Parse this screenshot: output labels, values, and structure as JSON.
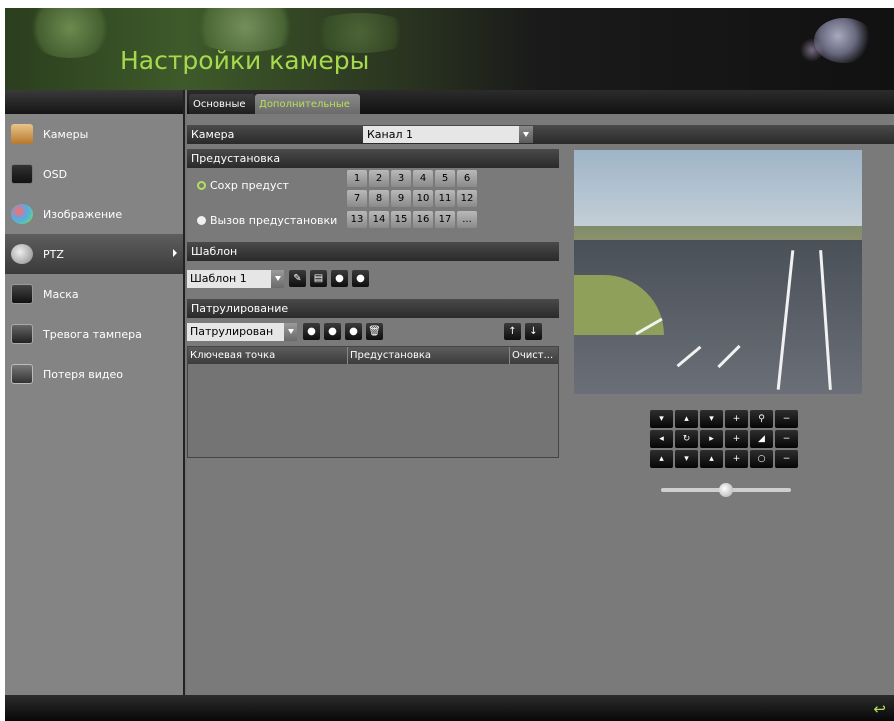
{
  "header": {
    "title": "Настройки камеры"
  },
  "sidebar": {
    "items": [
      {
        "label": "Камеры",
        "icon": "camera-icon"
      },
      {
        "label": "OSD",
        "icon": "osd-icon"
      },
      {
        "label": "Изображение",
        "icon": "image-icon"
      },
      {
        "label": "PTZ",
        "icon": "ptz-icon",
        "active": true
      },
      {
        "label": "Маска",
        "icon": "mask-icon"
      },
      {
        "label": "Тревога тампера",
        "icon": "tamper-icon"
      },
      {
        "label": "Потеря видео",
        "icon": "video-loss-icon"
      }
    ]
  },
  "tabs": [
    {
      "label": "Основные",
      "active": false
    },
    {
      "label": "Дополнительные",
      "active": true
    }
  ],
  "camera": {
    "label": "Камера",
    "value": "Канал 1"
  },
  "preset": {
    "section_title": "Предустановка",
    "save_label": "Сохр предуст",
    "call_label": "Вызов предустановки",
    "buttons": [
      "1",
      "2",
      "3",
      "4",
      "5",
      "6",
      "7",
      "8",
      "9",
      "10",
      "11",
      "12",
      "13",
      "14",
      "15",
      "16",
      "17",
      "..."
    ]
  },
  "pattern": {
    "section_title": "Шаблон",
    "value": "Шаблон 1"
  },
  "patrol": {
    "section_title": "Патрулирование",
    "value": "Патрулирован",
    "columns": [
      "Ключевая точка",
      "Предустановка",
      "Очист..."
    ]
  },
  "colors": {
    "accent": "#b6e05a",
    "panel": "#757575",
    "bar": "#2a2a2a"
  }
}
